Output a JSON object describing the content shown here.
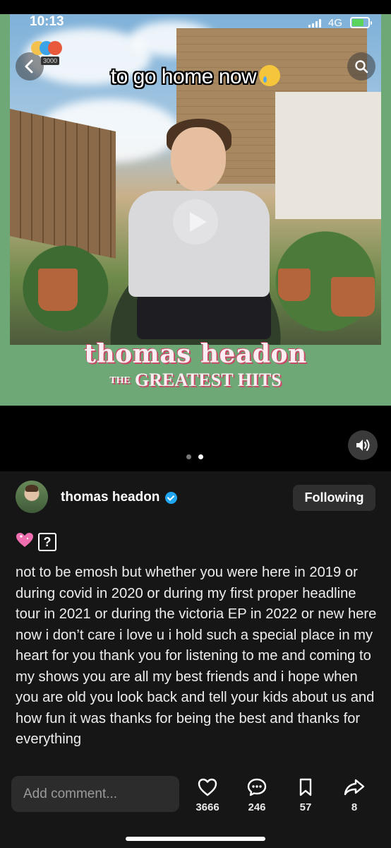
{
  "status_bar": {
    "time": "10:13",
    "network": "4G",
    "battery_color": "#5bd45b"
  },
  "media": {
    "caption": "to go home now",
    "caption_emoji": "crying-face",
    "album_title": "thomas headon",
    "album_subtitle_prefix": "THE",
    "album_subtitle": "GREATEST HITS",
    "app_badge_tag": "3000",
    "background_color": "#6fa877",
    "page_count": 2,
    "active_page": 1
  },
  "icons": {
    "back": "chevron-left-icon",
    "search": "search-icon",
    "sound": "speaker-icon",
    "like": "heart-icon",
    "comment": "chat-bubble-icon",
    "save": "bookmark-icon",
    "share": "share-arrow-icon"
  },
  "post": {
    "username": "thomas headon",
    "verified": true,
    "follow_label": "Following",
    "emoji_line": [
      "sparkling-heart",
      "?"
    ],
    "description": "not to be emosh but whether you were here in 2019 or during covid in 2020 or during my first proper headline tour in 2021 or during the victoria EP in 2022 or new here now i don’t care i love u i hold such a special place in my heart for you thank you for listening to me and coming to my shows you are all my best friends and i hope when you are old you look back and tell your kids about us and how fun it was thanks for being the best and thanks for everything"
  },
  "bottom_bar": {
    "comment_placeholder": "Add comment...",
    "likes": "3666",
    "comments": "246",
    "saves": "57",
    "shares": "8"
  }
}
